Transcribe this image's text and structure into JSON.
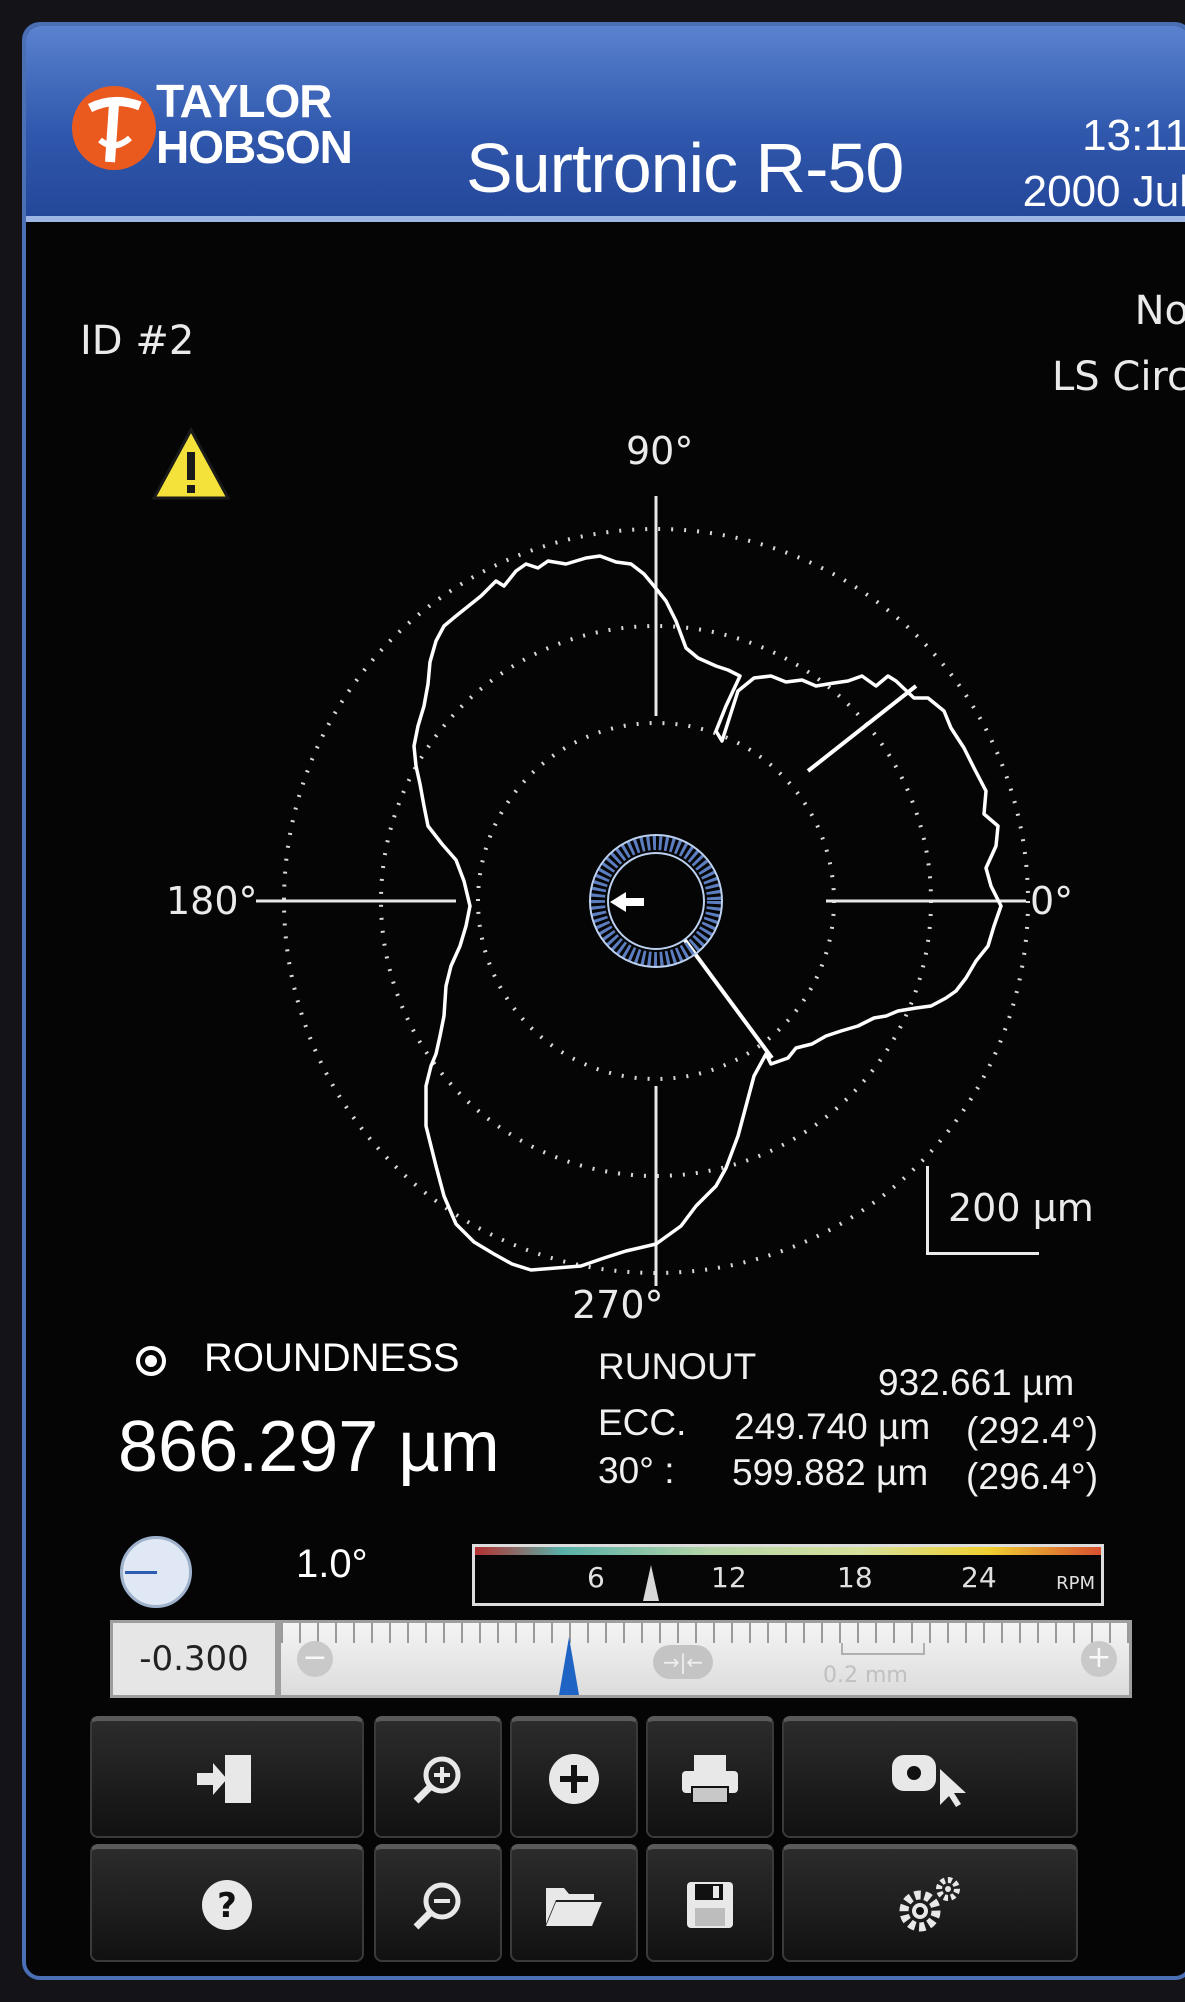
{
  "header": {
    "brand_line1": "TAYLOR",
    "brand_line2": "HOBSON",
    "title": "Surtronic R-50",
    "time": "13:11",
    "date": "2000 Jul"
  },
  "info": {
    "id": "ID #2",
    "right_line1": "No",
    "right_line2": "LS Circ"
  },
  "plot": {
    "label_90": "90°",
    "label_180": "180°",
    "label_0": "0°",
    "label_270": "270°",
    "scale": "200  µm"
  },
  "results": {
    "parameter": "ROUNDNESS",
    "value": "866.297 µm",
    "runout_label": "RUNOUT",
    "runout_value": "932.661 µm",
    "ecc_label": "ECC.",
    "ecc_value": "249.740 µm",
    "ecc_angle": "(292.4°)",
    "deg30_label": "30° :",
    "deg30_value": "599.882 µm",
    "deg30_angle": "(296.4°)"
  },
  "speed": {
    "angle": "1.0°",
    "ticks": [
      "6",
      "12",
      "18",
      "24"
    ],
    "unit": "RPM"
  },
  "position": {
    "value": "-0.300",
    "range_label": "0.2 mm"
  },
  "icons": {
    "row1": [
      "exit-icon",
      "zoom-in-icon",
      "add-icon",
      "print-icon",
      "record-icon"
    ],
    "row2": [
      "help-icon",
      "zoom-out-icon",
      "open-folder-icon",
      "save-icon",
      "settings-icon"
    ]
  }
}
